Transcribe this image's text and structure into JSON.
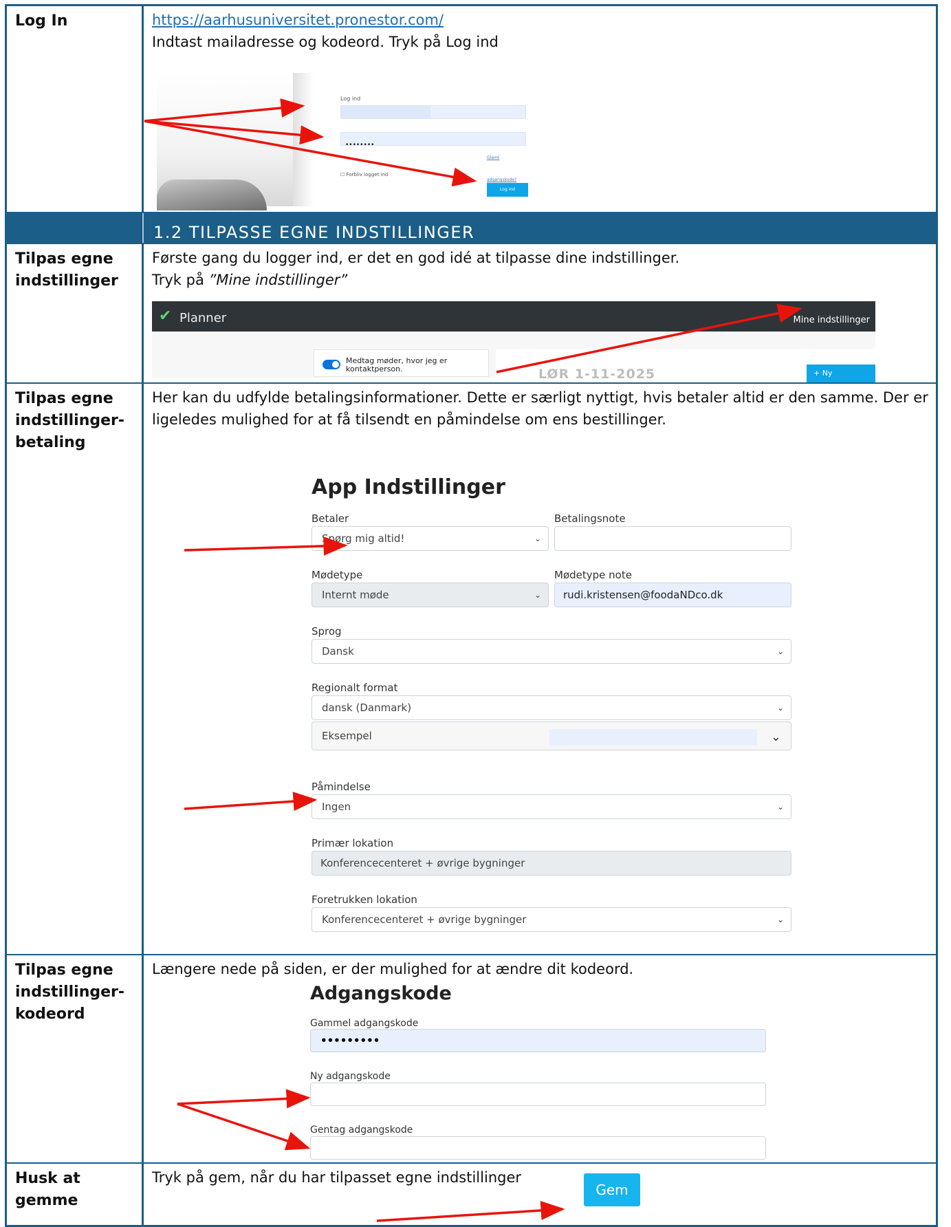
{
  "login": {
    "label": "Log In",
    "url": "https://aarhusuniversitet.pronestor.com/",
    "instruction": "Indtast mailadresse og kodeord. Tryk på Log ind",
    "mini": {
      "title": "Log ind",
      "password_dots": "••••••••",
      "forgot": "Glemt adgangskode?",
      "stay_logged": "Forbliv logget ind",
      "button": "Log ind"
    }
  },
  "section": {
    "title": "1.2 TILPASSE EGNE INDSTILLINGER"
  },
  "settings": {
    "label": "Tilpas egne indstillinger",
    "line1": "Første gang du logger ind, er det en god idé at tilpasse dine indstillinger.",
    "line2_prefix": "Tryk på ",
    "line2_em": "”Mine indstillinger”",
    "planner": {
      "app_name": "Planner",
      "mine_link": "Mine indstillinger",
      "toggle_text": "Medtag møder, hvor jeg er kontaktperson.",
      "date": "LØR 1-11-2025",
      "new_button": "+ Ny mødebestill"
    }
  },
  "payment": {
    "label": "Tilpas egne indstillinger-betaling",
    "text": "Her kan du udfylde betalingsinformationer.  Dette er særligt nyttigt, hvis betaler altid er den samme. Der er ligeledes mulighed for at få tilsendt en påmindelse om ens bestillinger.",
    "form": {
      "heading": "App Indstillinger",
      "betaler_label": "Betaler",
      "betaler_value": "Spørg mig altid!",
      "betalingsnote_label": "Betalingsnote",
      "betalingsnote_value": "",
      "modetype_label": "Mødetype",
      "modetype_value": "Internt møde",
      "modetype_note_label": "Mødetype note",
      "modetype_note_value": "rudi.kristensen@foodaNDco.dk",
      "sprog_label": "Sprog",
      "sprog_value": "Dansk",
      "regional_label": "Regionalt format",
      "regional_value": "dansk (Danmark)",
      "eksempel_label": "Eksempel",
      "paamindelse_label": "Påmindelse",
      "paamindelse_value": "Ingen",
      "primaer_label": "Primær lokation",
      "primaer_value": "Konferencecenteret + øvrige bygninger",
      "foretrukken_label": "Foretrukken lokation",
      "foretrukken_value": "Konferencecenteret + øvrige bygninger"
    }
  },
  "password": {
    "label": "Tilpas egne indstillinger-kodeord",
    "text": "Længere nede på siden, er der mulighed for at ændre dit kodeord.",
    "form": {
      "heading": "Adgangskode",
      "old_label": "Gammel adgangskode",
      "old_value": "•••••••••",
      "new_label": "Ny adgangskode",
      "repeat_label": "Gentag adgangskode"
    }
  },
  "save": {
    "label": "Husk at gemme",
    "text": "Tryk på gem, når du har tilpasset egne indstillinger",
    "button": "Gem"
  },
  "colors": {
    "border": "#1b5e87",
    "arrow": "#e8140c",
    "button": "#18b4ee"
  }
}
